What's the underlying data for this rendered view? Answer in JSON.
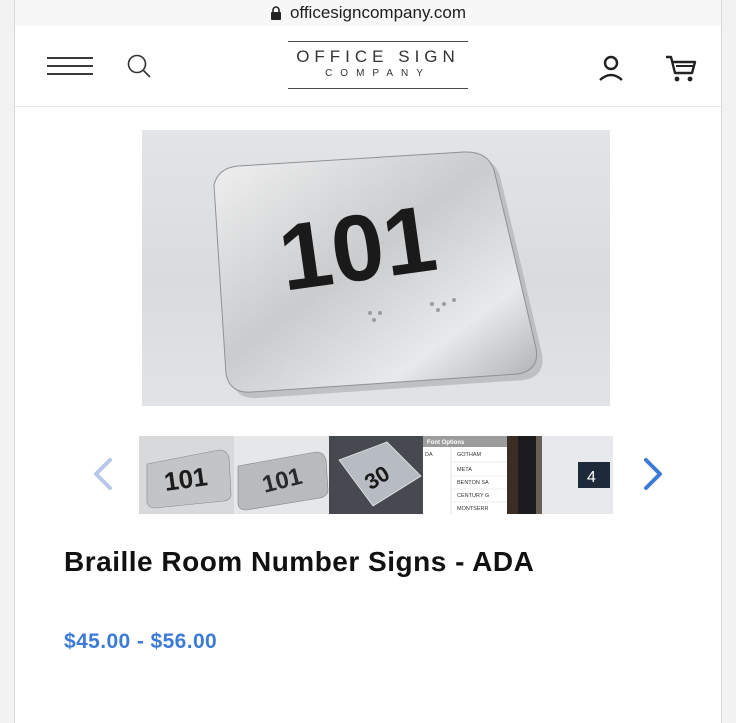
{
  "browser": {
    "url": "officesigncompany.com"
  },
  "header": {
    "logo_line1": "OFFICE SIGN",
    "logo_line2": "COMPANY",
    "icons": [
      "menu-icon",
      "search-icon",
      "account-icon",
      "cart-icon"
    ]
  },
  "product": {
    "image_text": "101",
    "thumbnails": [
      {
        "text": "101"
      },
      {
        "text": "101"
      },
      {
        "text": "30"
      },
      {
        "header": "Font Options",
        "fonts": [
          "GOTHAM",
          "META",
          "BENTON SA",
          "CENTURY G",
          "MONTSERR"
        ],
        "left_text": "DA"
      },
      {
        "text": "4"
      }
    ],
    "title": "Braille Room Number Signs - ADA",
    "price": "$45.00 - $56.00"
  },
  "colors": {
    "accent": "#3d7bd8",
    "arrow_disabled": "#b8c8ea",
    "arrow_active": "#3d7bd8"
  }
}
